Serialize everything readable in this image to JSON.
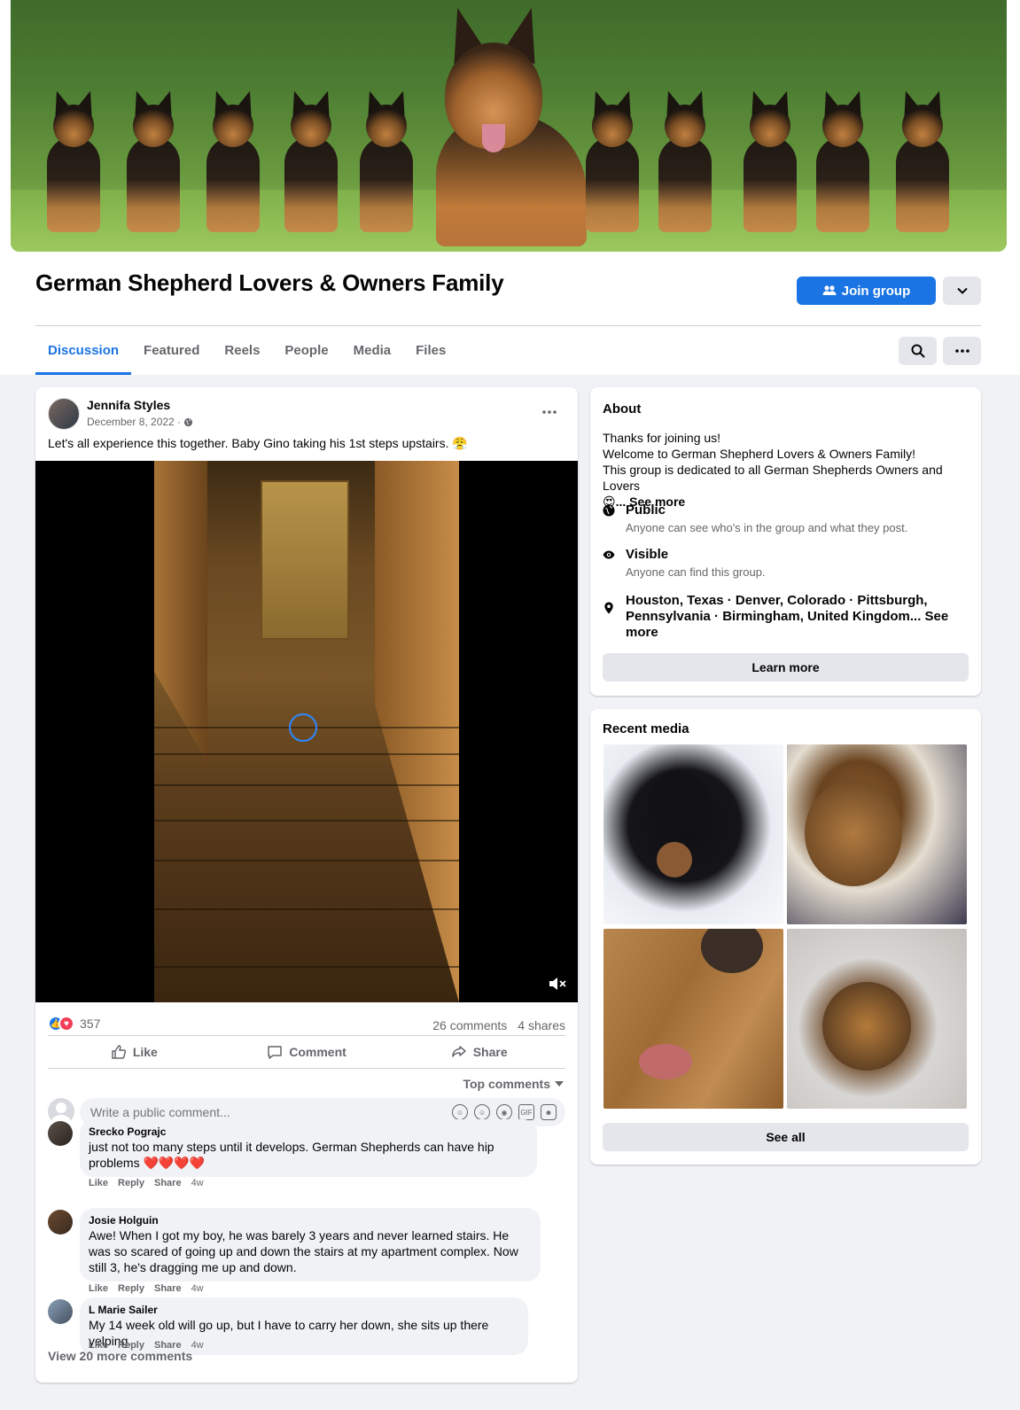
{
  "group": {
    "title": "German Shepherd Lovers & Owners Family",
    "join_label": "Join group"
  },
  "tabs": [
    "Discussion",
    "Featured",
    "Reels",
    "People",
    "Media",
    "Files"
  ],
  "post": {
    "author": "Jennifa Styles",
    "date": "December 8, 2022 ·",
    "text": "Let's all experience this together. Baby Gino taking his 1st steps upstairs. 😤",
    "reaction_count": "357",
    "comments_count": "26 comments",
    "shares_count": "4 shares",
    "actions": {
      "like": "Like",
      "comment": "Comment",
      "share": "Share"
    },
    "sort_label": "Top comments",
    "comment_placeholder": "Write a public comment...",
    "comments": [
      {
        "name": "Srecko Pograjc",
        "text": "just not too many steps until it develops. German Shepherds can have hip problems ❤️❤️❤️❤️",
        "like": "Like",
        "reply": "Reply",
        "share": "Share",
        "time": "4w"
      },
      {
        "name": "Josie Holguin",
        "text": "Awe! When I got my boy, he was barely 3 years and never learned stairs. He was so scared of going up and down the stairs at my apartment complex. Now still 3, he's dragging me up and down.",
        "like": "Like",
        "reply": "Reply",
        "share": "Share",
        "time": "4w"
      },
      {
        "name": "L Marie Sailer",
        "text": "My 14 week old will go up, but I have to carry her down, she sits up there yelping.",
        "like": "Like",
        "reply": "Reply",
        "share": "Share",
        "time": "4w"
      }
    ],
    "view_more": "View 20 more comments"
  },
  "about": {
    "heading": "About",
    "line1": "Thanks for joining us!",
    "line2": "Welcome to German Shepherd Lovers & Owners Family!",
    "line3": "This group is dedicated to all German Shepherds Owners and Lovers",
    "line4_emoji": "😍",
    "see_more": "... See more",
    "public_title": "Public",
    "public_sub": "Anyone can see who's in the group and what they post.",
    "visible_title": "Visible",
    "visible_sub": "Anyone can find this group.",
    "locations": "Houston, Texas · Denver, Colorado · Pittsburgh, Pennsylvania · Birmingham, United Kingdom... See more",
    "learn_more": "Learn more"
  },
  "recent_media": {
    "heading": "Recent media",
    "see_all": "See all"
  },
  "colors": {
    "accent": "#1b74e4",
    "like": "#1877f2",
    "love": "#f33e58"
  }
}
